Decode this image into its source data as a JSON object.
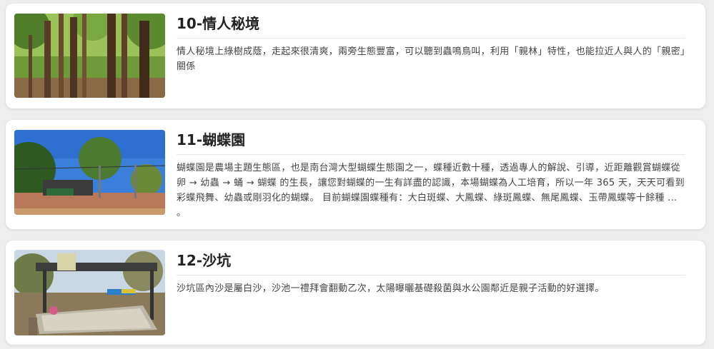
{
  "attractions": [
    {
      "title": "10-情人秘境",
      "description": "情人秘境上綠樹成蔭，走起來很清爽，兩旁生態豐富，可以聽到蟲鳴鳥叫，利用「親林」特性，也能拉近人與人的「親密」關係",
      "image_icon": "forest-path-photo"
    },
    {
      "title": "11-蝴蝶園",
      "description": "蝴蝶園是農場主題生態區，也是南台灣大型蝴蝶生態園之一，蝶種近數十種，透過專人的解說、引導，近距離觀賞蝴蝶從 卵 → 幼蟲 → 蛹 → 蝴蝶 的生長，讓您對蝴蝶的一生有詳盡的認識，本場蝴蝶為人工培育，所以一年 365 天，天天可看到彩蝶飛舞、幼蟲或剛羽化的蝴蝶。 目前蝴蝶園蝶種有：大白斑蝶、大鳳蝶、綠斑鳳蝶、無尾鳳蝶、玉帶鳳蝶等十餘種 ... 。",
      "image_icon": "butterfly-garden-photo"
    },
    {
      "title": "12-沙坑",
      "description": "沙坑區內沙是屬白沙，沙池一禮拜會翻動乙次，太陽曝曬基礎殺菌與水公園鄰近是親子活動的好選擇。",
      "image_icon": "sandpit-photo"
    }
  ]
}
